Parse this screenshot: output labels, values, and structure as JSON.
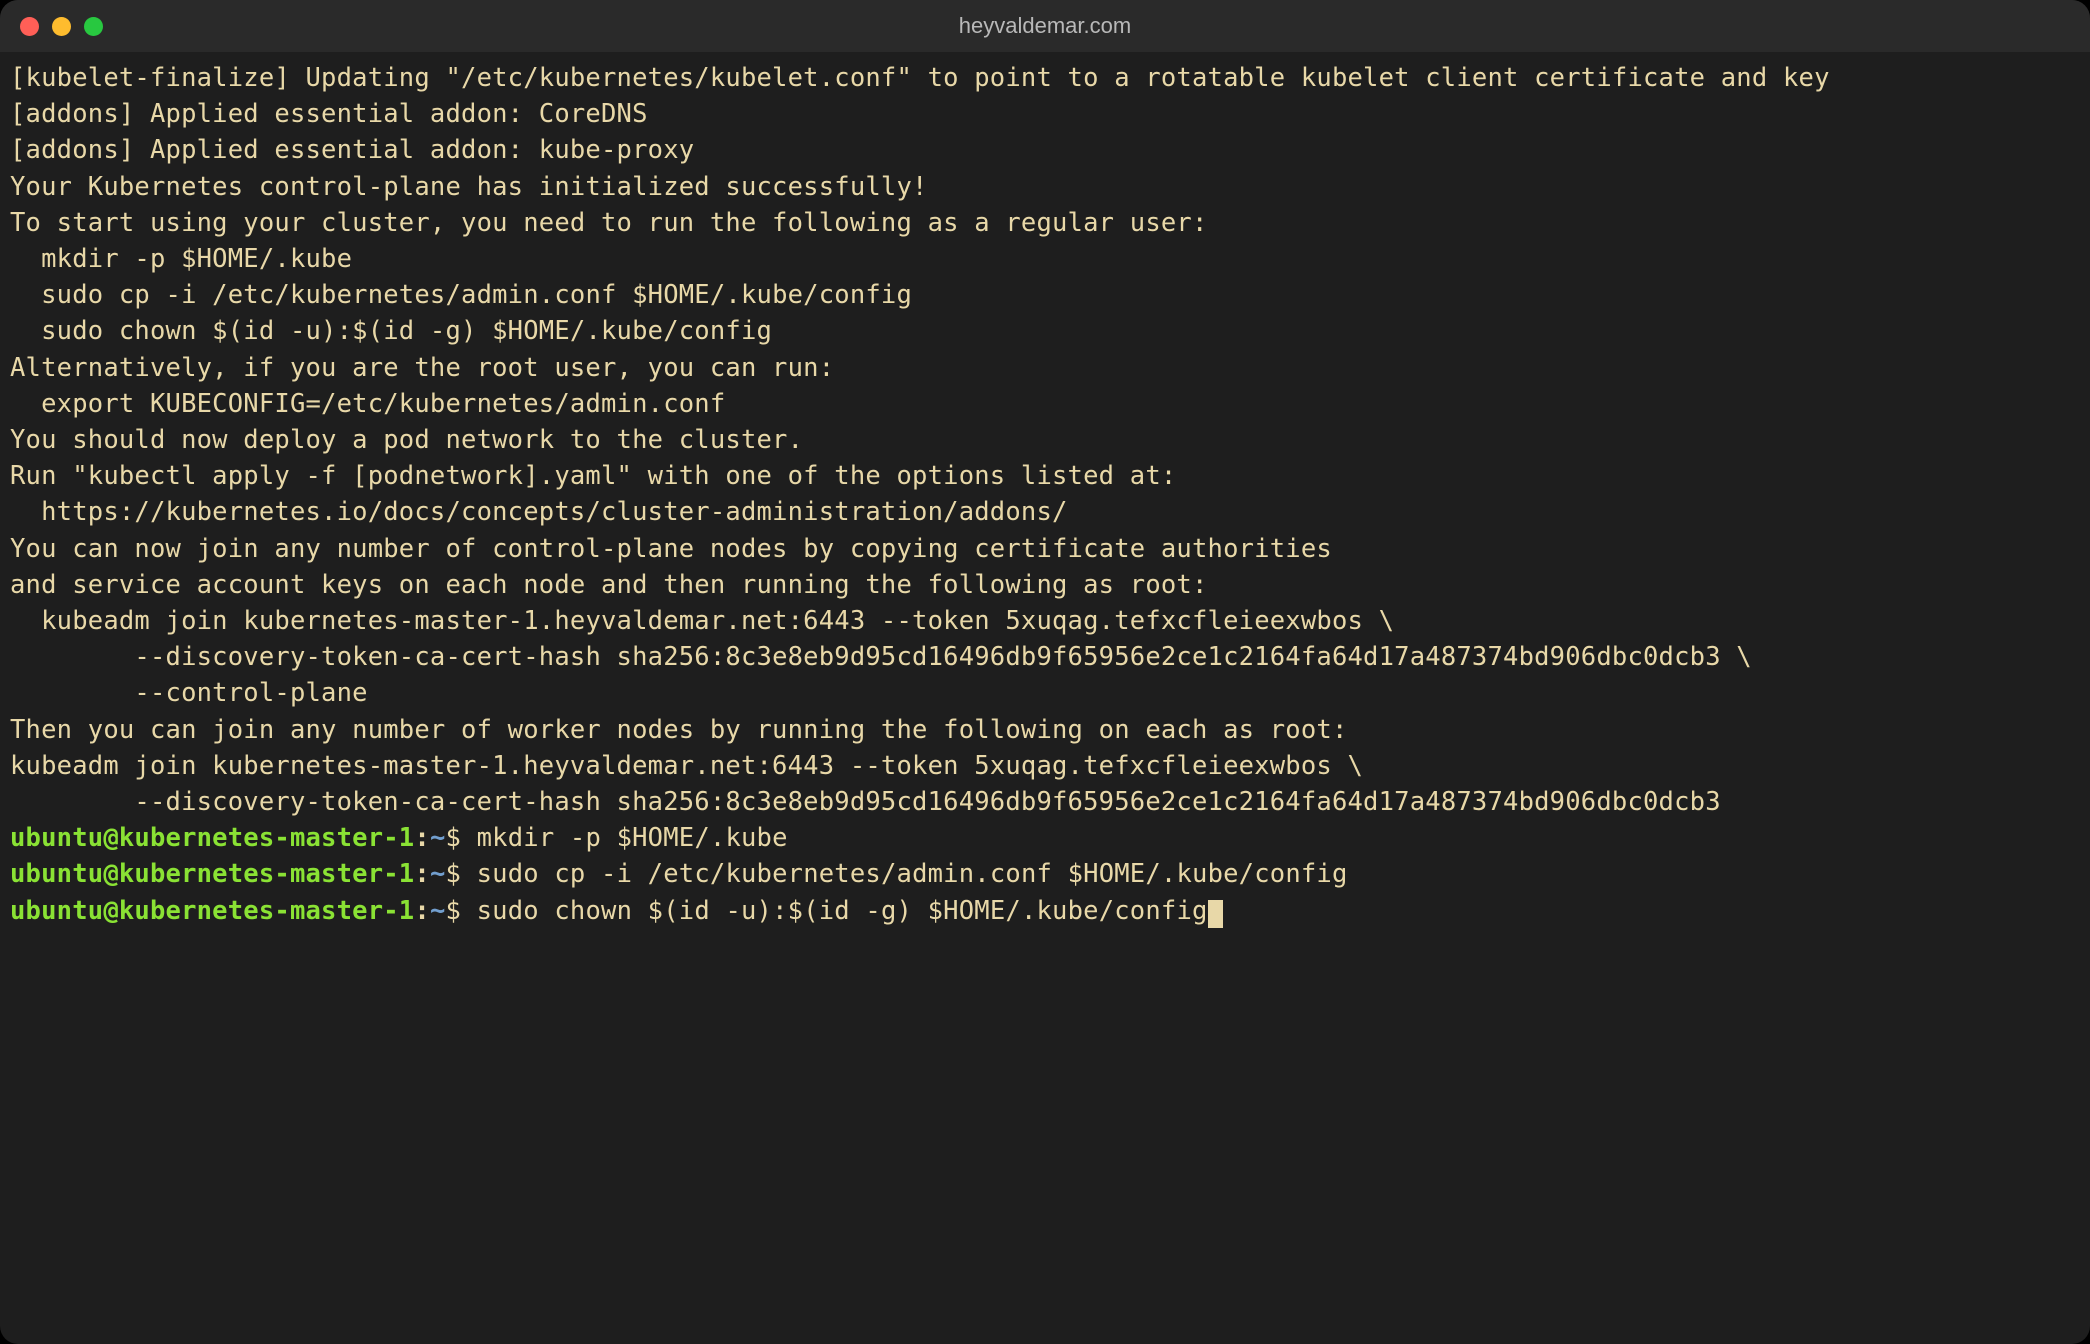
{
  "window": {
    "title": "heyvaldemar.com"
  },
  "output": {
    "l0": "[kubelet-finalize] Updating \"/etc/kubernetes/kubelet.conf\" to point to a rotatable kubelet client certificate and key",
    "l1": "[addons] Applied essential addon: CoreDNS",
    "l2": "[addons] Applied essential addon: kube-proxy",
    "blank": "",
    "l3": "Your Kubernetes control-plane has initialized successfully!",
    "l4": "To start using your cluster, you need to run the following as a regular user:",
    "l5": "  mkdir -p $HOME/.kube",
    "l6": "  sudo cp -i /etc/kubernetes/admin.conf $HOME/.kube/config",
    "l7": "  sudo chown $(id -u):$(id -g) $HOME/.kube/config",
    "l8": "Alternatively, if you are the root user, you can run:",
    "l9": "  export KUBECONFIG=/etc/kubernetes/admin.conf",
    "l10": "You should now deploy a pod network to the cluster.",
    "l11": "Run \"kubectl apply -f [podnetwork].yaml\" with one of the options listed at:",
    "l12": "  https://kubernetes.io/docs/concepts/cluster-administration/addons/",
    "l13": "You can now join any number of control-plane nodes by copying certificate authorities",
    "l14": "and service account keys on each node and then running the following as root:",
    "l15": "  kubeadm join kubernetes-master-1.heyvaldemar.net:6443 --token 5xuqag.tefxcfleieexwbos \\",
    "l16": "        --discovery-token-ca-cert-hash sha256:8c3e8eb9d95cd16496db9f65956e2ce1c2164fa64d17a487374bd906dbc0dcb3 \\",
    "l17": "        --control-plane",
    "l18": "Then you can join any number of worker nodes by running the following on each as root:",
    "l19": "kubeadm join kubernetes-master-1.heyvaldemar.net:6443 --token 5xuqag.tefxcfleieexwbos \\",
    "l20": "        --discovery-token-ca-cert-hash sha256:8c3e8eb9d95cd16496db9f65956e2ce1c2164fa64d17a487374bd906dbc0dcb3"
  },
  "prompts": [
    {
      "user": "ubuntu@kubernetes-master-1",
      "colon": ":",
      "path": "~",
      "dollar": "$ ",
      "cmd": "mkdir -p $HOME/.kube"
    },
    {
      "user": "ubuntu@kubernetes-master-1",
      "colon": ":",
      "path": "~",
      "dollar": "$ ",
      "cmd": "sudo cp -i /etc/kubernetes/admin.conf $HOME/.kube/config"
    },
    {
      "user": "ubuntu@kubernetes-master-1",
      "colon": ":",
      "path": "~",
      "dollar": "$ ",
      "cmd": "sudo chown $(id -u):$(id -g) $HOME/.kube/config"
    }
  ]
}
